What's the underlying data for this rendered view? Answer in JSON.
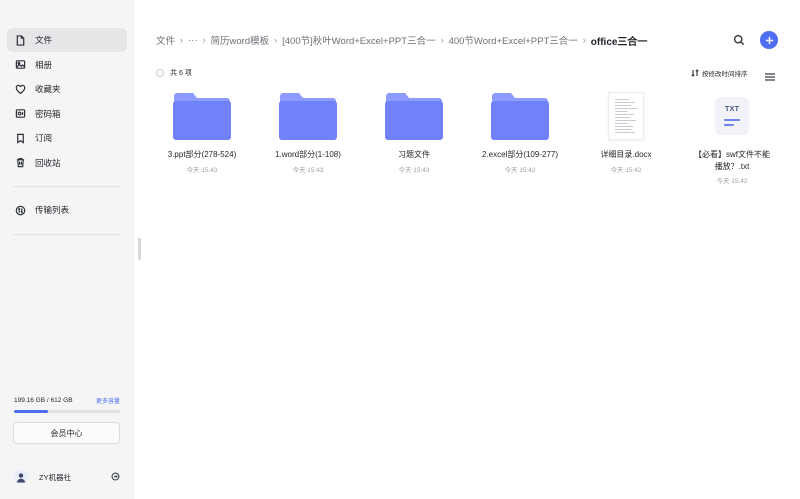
{
  "sidebar": {
    "items": [
      {
        "label": "文件",
        "icon": "file-icon"
      },
      {
        "label": "相册",
        "icon": "image-icon"
      },
      {
        "label": "收藏夹",
        "icon": "heart-icon"
      },
      {
        "label": "密码箱",
        "icon": "safe-icon"
      },
      {
        "label": "订阅",
        "icon": "bookmark-icon"
      },
      {
        "label": "回收站",
        "icon": "trash-icon"
      }
    ],
    "transfer_label": "传输列表",
    "storage_text": "199.16 GB / 612 GB",
    "storage_more": "更多容量",
    "storage_used_fraction": 0.325,
    "vip_label": "会员中心",
    "user_name": "ZY机器社"
  },
  "breadcrumb": {
    "items": [
      "文件",
      "···",
      "简历word模板",
      "[400节]秋叶Word+Excel+PPT三合一",
      "400节Word+Excel+PPT三合一"
    ],
    "current": "office三合一"
  },
  "toolbar": {
    "count_label": "共 6 项",
    "sort_label": "按修改时间排序"
  },
  "files": [
    {
      "name": "3.ppt部分(278-524)",
      "date": "今天 15:43",
      "type": "folder"
    },
    {
      "name": "1.word部分(1-108)",
      "date": "今天 15:43",
      "type": "folder"
    },
    {
      "name": "习题文件",
      "date": "今天 15:43",
      "type": "folder"
    },
    {
      "name": "2.excel部分(109-277)",
      "date": "今天 15:42",
      "type": "folder"
    },
    {
      "name": "详细目录.docx",
      "date": "今天 15:42",
      "type": "docx"
    },
    {
      "name": "【必看】swf文件不能播放？.txt",
      "date": "今天 15:42",
      "type": "txt",
      "badge": "TXT"
    }
  ],
  "colors": {
    "accent": "#4e6ef2",
    "folder_top": "#8d9bff",
    "folder_body": "#6f82f7"
  }
}
